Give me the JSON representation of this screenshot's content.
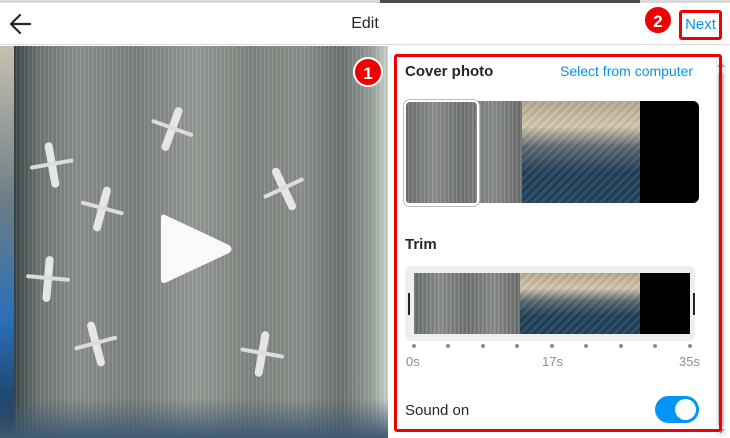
{
  "header": {
    "back_icon": "arrow-left-icon",
    "title": "Edit",
    "next_label": "Next"
  },
  "annotations": {
    "badge_1": "1",
    "badge_2": "2",
    "highlight_color": "#e00000"
  },
  "media": {
    "play_icon": "play-icon"
  },
  "cover_photo": {
    "heading": "Cover photo",
    "select_link": "Select from computer"
  },
  "trim": {
    "heading": "Trim",
    "ticks": [
      "0s",
      "17s",
      "35s"
    ]
  },
  "sound": {
    "label": "Sound on",
    "enabled": true
  },
  "colors": {
    "accent": "#0095f6",
    "text": "#262626",
    "muted": "#8e8e8e"
  }
}
